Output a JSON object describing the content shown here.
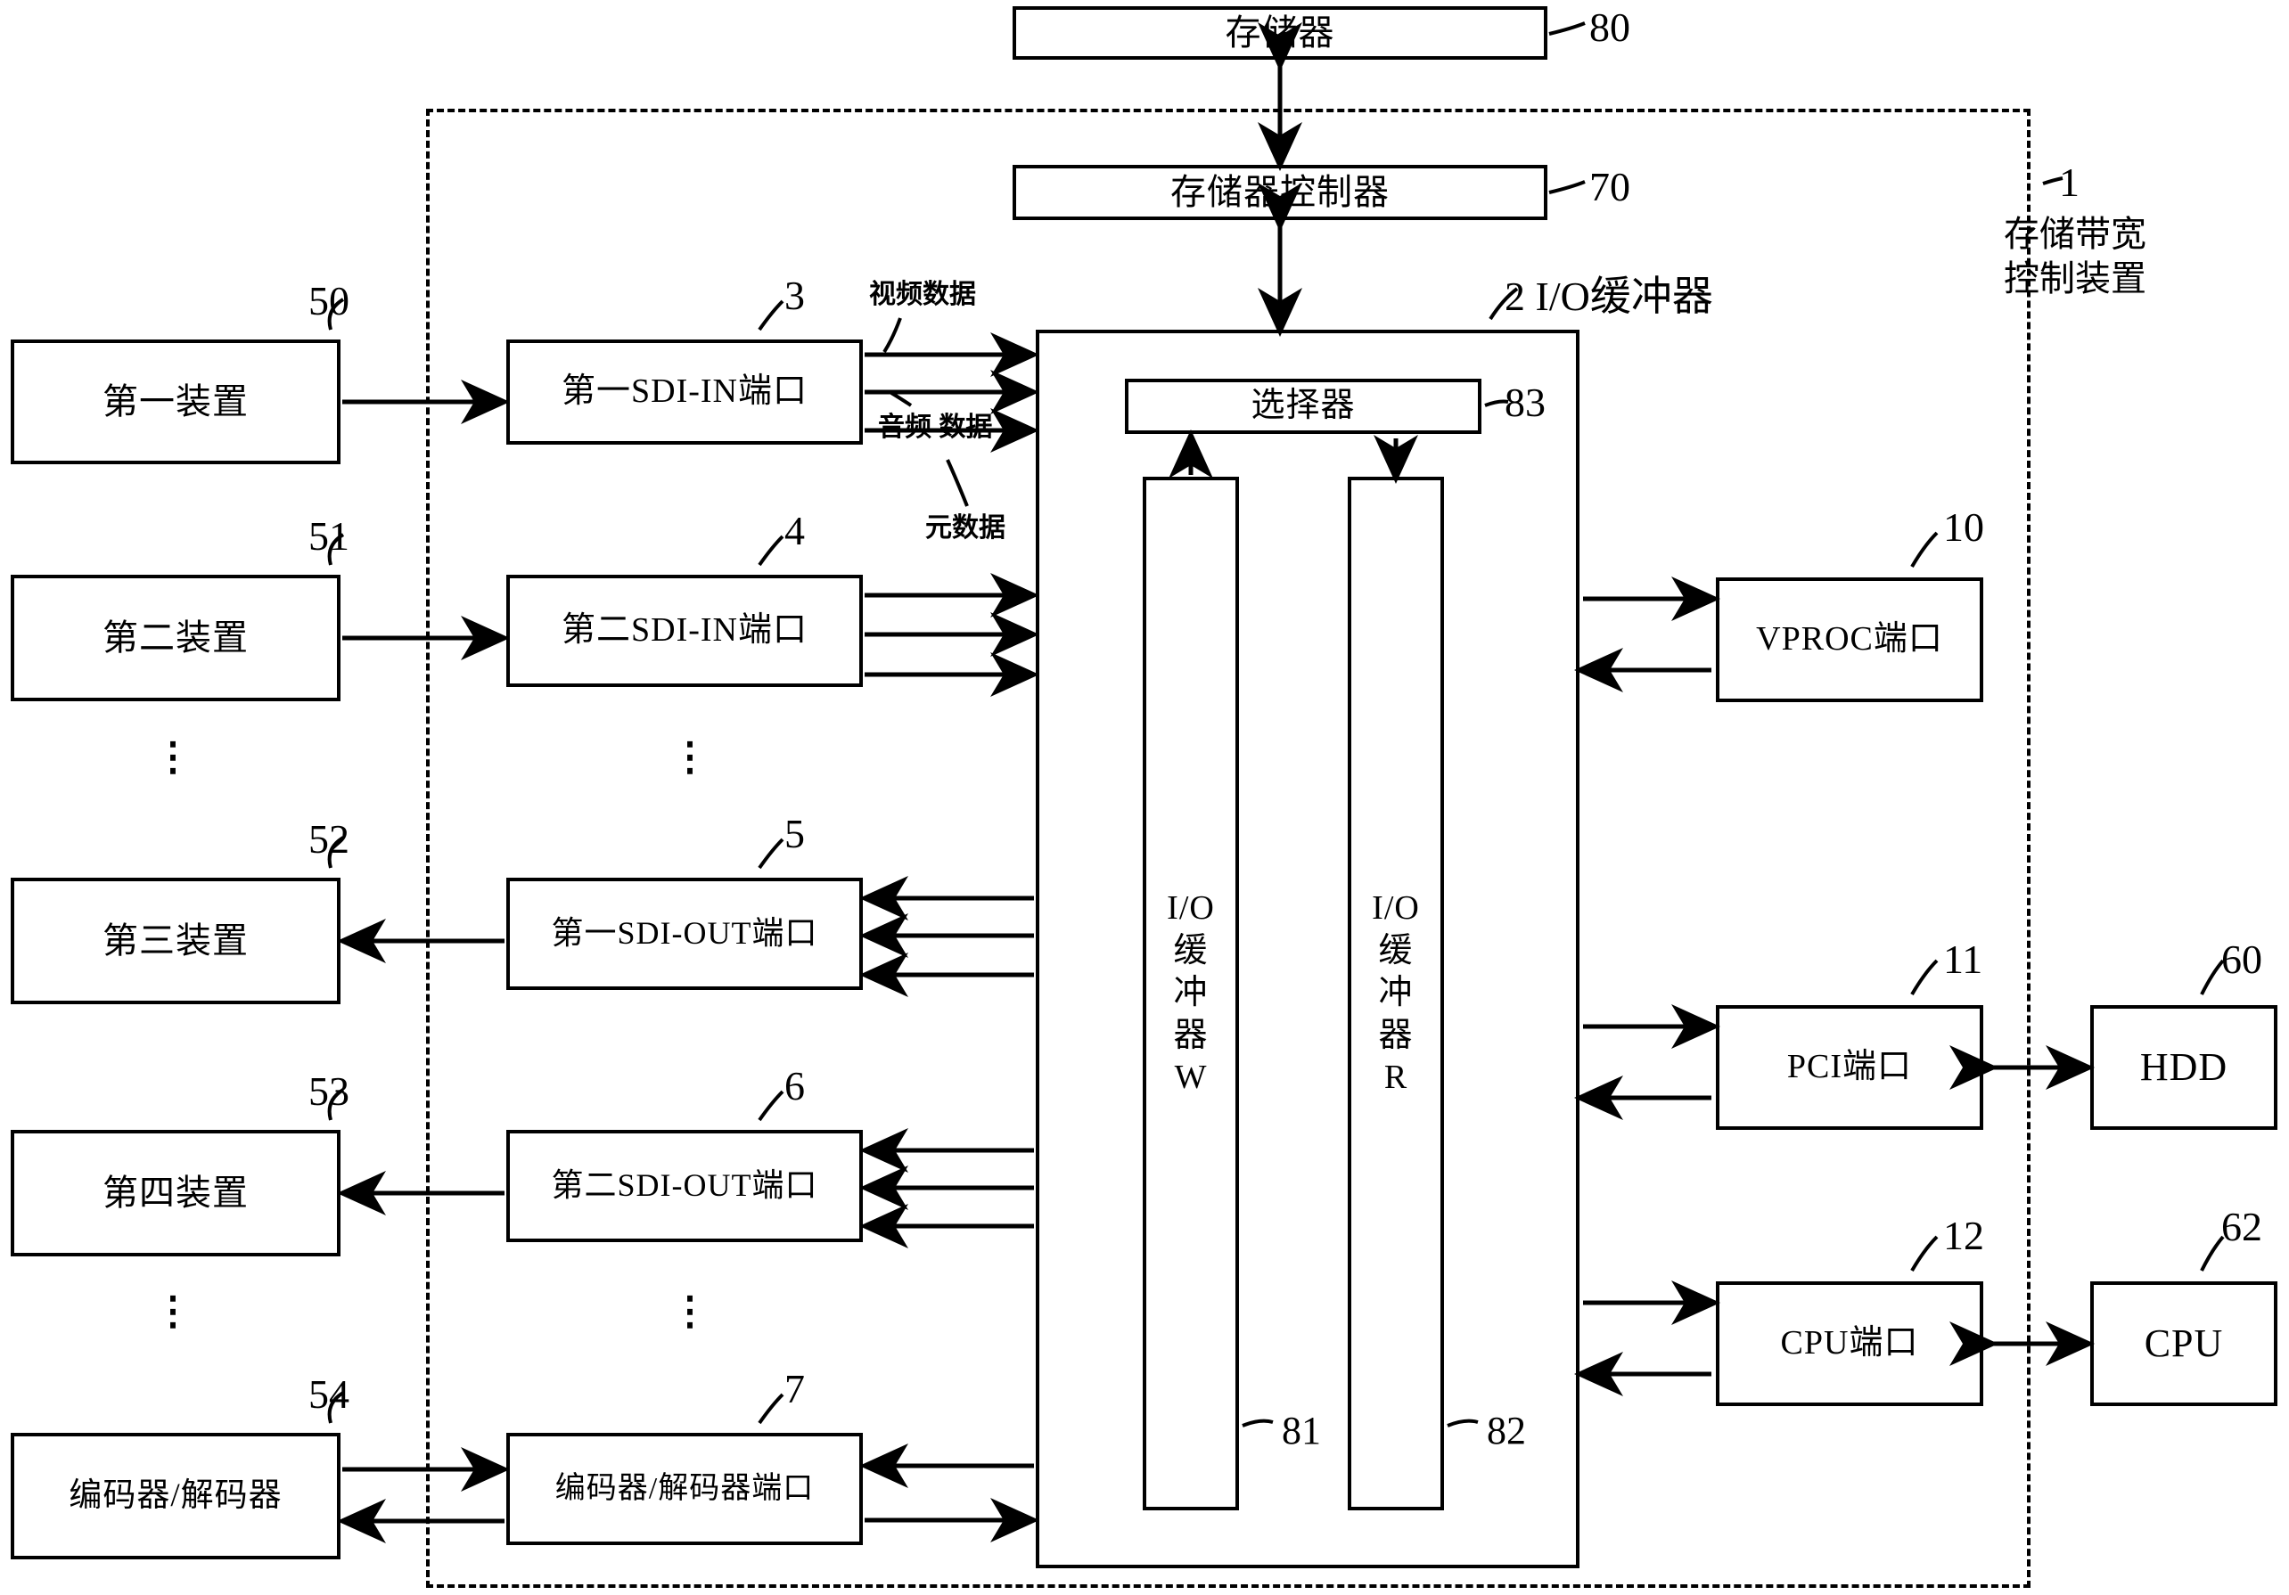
{
  "figure": {
    "system_label": {
      "ref": "1",
      "name": "存储带宽\n控制装置"
    },
    "memory": {
      "label": "存储器",
      "ref": "80"
    },
    "memory_controller": {
      "label": "存储器控制器",
      "ref": "70"
    },
    "io_buffer": {
      "label": "I/O缓冲器",
      "ref": "2"
    },
    "selector": {
      "label": "选择器",
      "ref": "83"
    },
    "buffer_w": {
      "label": "I/O\n缓\n冲\n器\nW",
      "ref": "81"
    },
    "buffer_r": {
      "label": "I/O\n缓\n冲\n器\nR",
      "ref": "82"
    },
    "signal_labels": {
      "video": "视频数据",
      "audio": "音频\n数据",
      "meta": "元数据"
    },
    "left_devices": [
      {
        "label": "第一装置",
        "ref": "50"
      },
      {
        "label": "第二装置",
        "ref": "51"
      },
      {
        "label": "第三装置",
        "ref": "52"
      },
      {
        "label": "第四装置",
        "ref": "53"
      },
      {
        "label": "编码器/解码器",
        "ref": "54"
      }
    ],
    "ports": [
      {
        "label": "第一SDI-IN端口",
        "ref": "3"
      },
      {
        "label": "第二SDI-IN端口",
        "ref": "4"
      },
      {
        "label": "第一SDI-OUT端口",
        "ref": "5"
      },
      {
        "label": "第二SDI-OUT端口",
        "ref": "6"
      },
      {
        "label": "编码器/解码器端口",
        "ref": "7"
      }
    ],
    "right_ports": [
      {
        "label": "VPROC端口",
        "ref": "10"
      },
      {
        "label": "PCI端口",
        "ref": "11"
      },
      {
        "label": "CPU端口",
        "ref": "12"
      }
    ],
    "right_devices": [
      {
        "label": "HDD",
        "ref": "60"
      },
      {
        "label": "CPU",
        "ref": "62"
      }
    ],
    "ellipsis": "⋮"
  }
}
